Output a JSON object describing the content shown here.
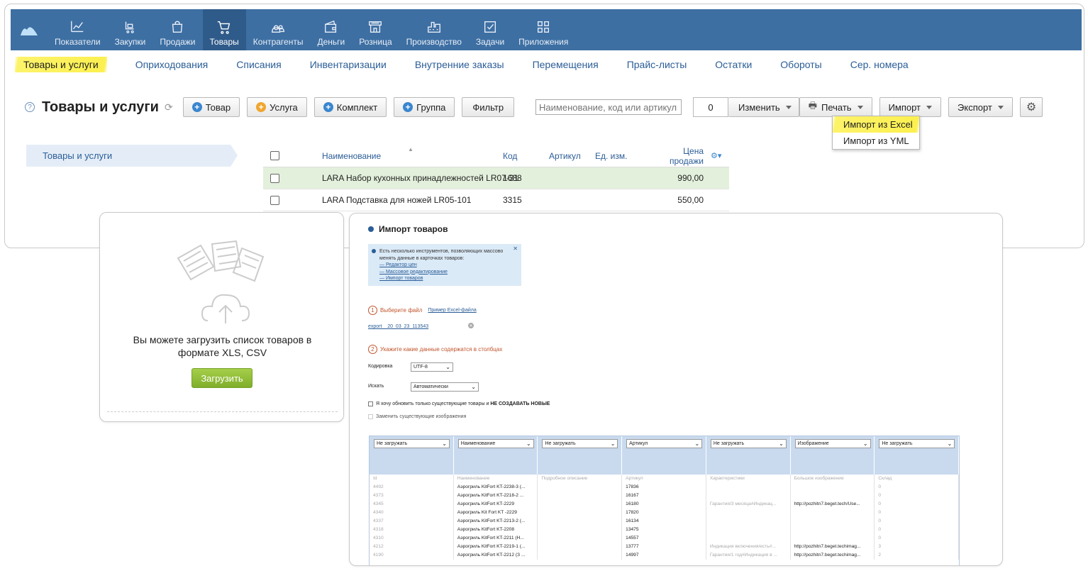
{
  "nav": {
    "items": [
      {
        "label": "Показатели",
        "icon": "chart-icon"
      },
      {
        "label": "Закупки",
        "icon": "purchases-icon"
      },
      {
        "label": "Продажи",
        "icon": "bag-icon"
      },
      {
        "label": "Товары",
        "icon": "cart-icon"
      },
      {
        "label": "Контрагенты",
        "icon": "people-icon"
      },
      {
        "label": "Деньги",
        "icon": "wallet-icon"
      },
      {
        "label": "Розница",
        "icon": "store-icon"
      },
      {
        "label": "Производство",
        "icon": "factory-icon"
      },
      {
        "label": "Задачи",
        "icon": "tasks-icon"
      },
      {
        "label": "Приложения",
        "icon": "apps-icon"
      }
    ],
    "active": "Товары"
  },
  "subnav": [
    "Товары и услуги",
    "Оприходования",
    "Списания",
    "Инвентаризации",
    "Внутренние заказы",
    "Перемещения",
    "Прайс-листы",
    "Остатки",
    "Обороты",
    "Сер. номера"
  ],
  "toolbar": {
    "title": "Товары и услуги",
    "btn_product": "Товар",
    "btn_service": "Услуга",
    "btn_kit": "Комплект",
    "btn_group": "Группа",
    "btn_filter": "Фильтр",
    "search_placeholder": "Наименование, код или артикул",
    "counter": "0",
    "btn_edit": "Изменить",
    "btn_print": "Печать",
    "btn_import": "Импорт",
    "btn_export": "Экспорт"
  },
  "import_menu": [
    "Импорт из Excel",
    "Импорт из YML"
  ],
  "sidebar": {
    "folder": "Товары и услуги"
  },
  "grid": {
    "columns": [
      "Наименование",
      "Код",
      "Артикул",
      "Ед. изм.",
      "Цена продажи"
    ],
    "rows": [
      {
        "name": "LARA Набор кухонных принадлежностей LR07-31",
        "code": "1688",
        "price": "990,00"
      },
      {
        "name": "LARA Подставка для ножей LR05-101",
        "code": "3315",
        "price": "550,00"
      }
    ]
  },
  "upload": {
    "text": "Вы можете загрузить список товаров в формате XLS, CSV",
    "button": "Загрузить"
  },
  "import_dialog": {
    "title": "Импорт товаров",
    "info_text": "Есть несколько инструментов, позволяющих массово менять данные в карточках товаров:",
    "info_links": [
      "— Редактор цен",
      "— Массовое редактирование",
      "— Импорт товаров"
    ],
    "step1": "Выберите файл",
    "step1_link": "Пример Excel-файла",
    "file_name": "export__20_03_23_113543",
    "step2": "Укажите какие данные содержатся в столбцах",
    "encoding_label": "Кодировка",
    "encoding_value": "UTF-8",
    "search_label": "Искать",
    "search_value": "Автоматически",
    "check1_text": "Я хочу обновить только существующие товары и",
    "check1_bold": "НЕ СОЗДАВАТЬ НОВЫЕ",
    "check2_text": "Заменить существующие изображения",
    "column_selects": [
      "Не загружать",
      "Наименование",
      "Не загружать",
      "Артикул",
      "Не загружать",
      "Изображение",
      "Не загружать"
    ],
    "table_header": [
      "Id",
      "Наименование",
      "Подробное описание",
      "Артикул",
      "Характеристики",
      "Большое изображение",
      "Склад"
    ],
    "table_rows": [
      [
        "4492",
        "Аэрогриль KitFort KT-2238-3 (...",
        "",
        "17836",
        "",
        "",
        "0"
      ],
      [
        "4373",
        "Аэрогриль KitFort KT-2218-2 ...",
        "",
        "16167",
        "",
        "",
        "0"
      ],
      [
        "4345",
        "Аэрогриль KitFort KT-2229",
        "",
        "16180",
        "Гарантия/3 месяца#Индикац...",
        "http://pozhitn7.beget.tech/Use...",
        "0"
      ],
      [
        "4340",
        "Аэрогриль Kit Fort KT -2229",
        "",
        "17820",
        "",
        "",
        "0"
      ],
      [
        "4337",
        "Аэрогриль KitFort KT-2213-2 (...",
        "",
        "16134",
        "",
        "",
        "0"
      ],
      [
        "4318",
        "Аэрогриль KitFort KT-2208",
        "",
        "13475",
        "",
        "",
        "0"
      ],
      [
        "4310",
        "Аэрогриль KitFort KT-2211 (Н...",
        "",
        "14557",
        "",
        "",
        "0"
      ],
      [
        "4212",
        "Аэрогриль KitFort KT-2219-1 (...",
        "",
        "13777",
        "Индикация включения/есть#...",
        "http://pozhitn7.beget.techimag...",
        "3"
      ],
      [
        "4190",
        "Аэрогриль KitFort KT-2212 (З ...",
        "",
        "14997",
        "Гарантия/1 год#Индикация в ...",
        "http://pozhitn7.beget.techimag...",
        "2"
      ]
    ]
  }
}
